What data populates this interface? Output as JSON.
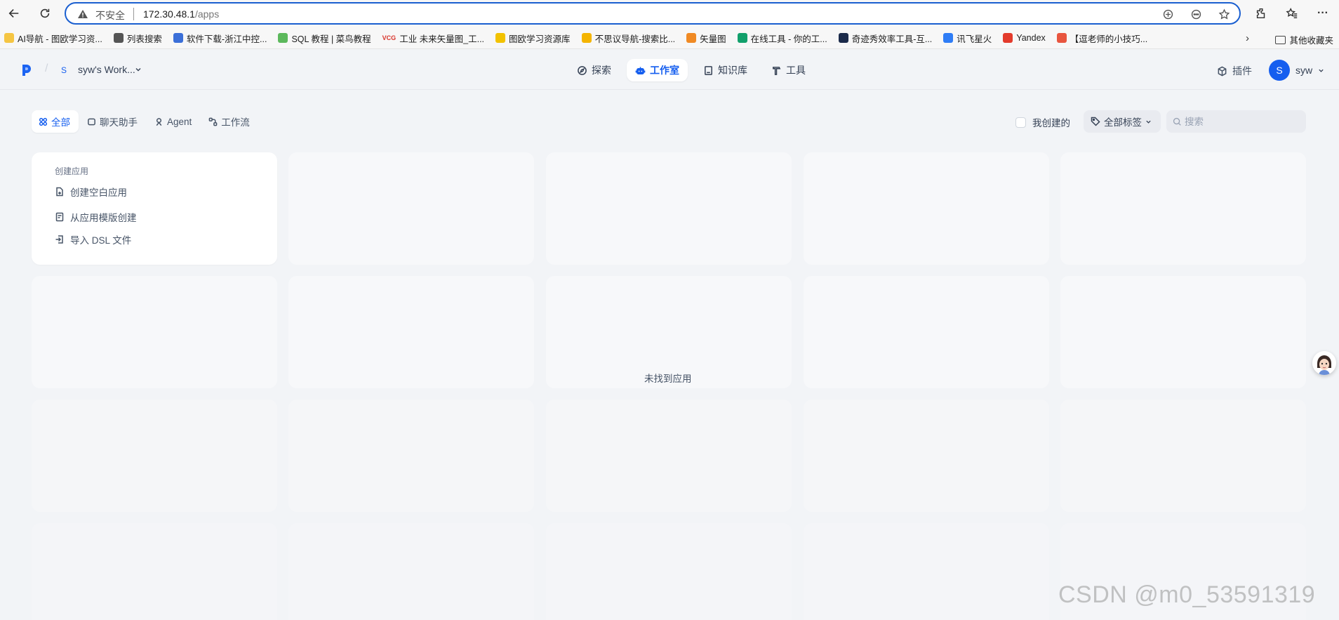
{
  "browser": {
    "insecure_label": "不安全",
    "url_host": "172.30.48.1",
    "url_path": "/apps",
    "more_label": "···"
  },
  "bookmarks": [
    {
      "label": "AI导航 - 图欧学习资...",
      "color": "#f5c542"
    },
    {
      "label": "列表搜索",
      "color": "#555555"
    },
    {
      "label": "软件下载-浙江中控...",
      "color": "#3b6fd8"
    },
    {
      "label": "SQL 教程 | 菜鸟教程",
      "color": "#5cb85c"
    },
    {
      "label": "工业 未来矢量图_工...",
      "color": "#d9342b",
      "prefix": "VCG"
    },
    {
      "label": "图欧学习资源库",
      "color": "#f2c200"
    },
    {
      "label": "不思议导航-搜索比...",
      "color": "#f4b400"
    },
    {
      "label": "矢量图",
      "color": "#f08a24"
    },
    {
      "label": "在线工具 - 你的工...",
      "color": "#12a06b"
    },
    {
      "label": "奇迹秀效率工具-互...",
      "color": "#1b2a4a"
    },
    {
      "label": "讯飞星火",
      "color": "#2f7df6"
    },
    {
      "label": "Yandex",
      "color": "#e33b2c"
    },
    {
      "label": "【逗老师的小技巧...",
      "color": "#e8553e"
    }
  ],
  "bookmarks_folder": "其他收藏夹",
  "header": {
    "workspace_avatar": "S",
    "workspace_name": "syw's Work...",
    "nav": [
      {
        "label": "探索",
        "active": false
      },
      {
        "label": "工作室",
        "active": true
      },
      {
        "label": "知识库",
        "active": false
      },
      {
        "label": "工具",
        "active": false
      }
    ],
    "plugin_label": "插件",
    "user_avatar": "S",
    "user_name": "syw"
  },
  "filters": {
    "tabs": [
      "全部",
      "聊天助手",
      "Agent",
      "工作流"
    ],
    "active_tab": "全部",
    "my_created_label": "我创建的",
    "tag_filter_label": "全部标签",
    "search_placeholder": "搜索"
  },
  "create_card": {
    "title": "创建应用",
    "items": [
      "创建空白应用",
      "从应用模版创建",
      "导入 DSL 文件"
    ]
  },
  "empty_message": "未找到应用",
  "watermark": "CSDN @m0_53591319",
  "colors": {
    "accent": "#155eef",
    "background": "#f2f4f7"
  }
}
